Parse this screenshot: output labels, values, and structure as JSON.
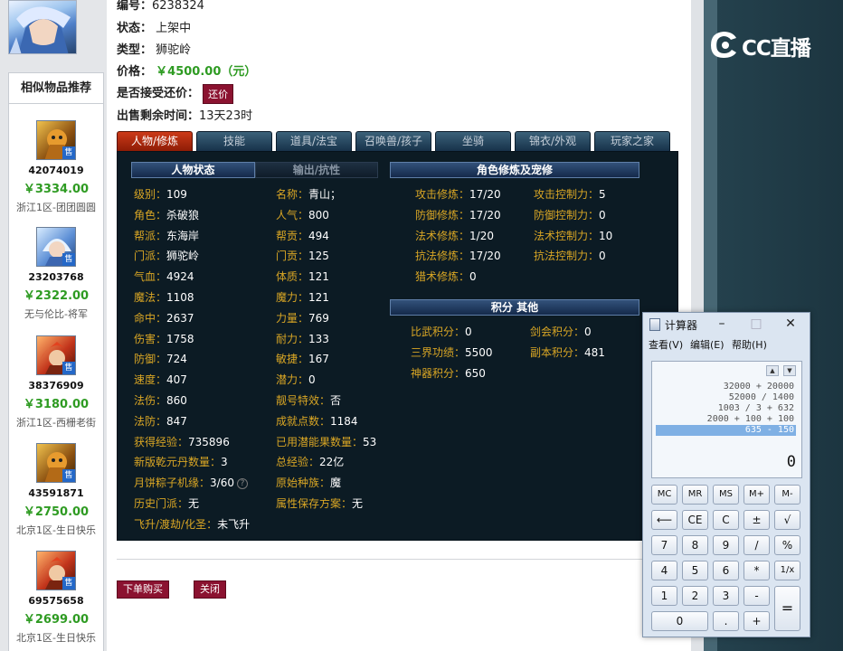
{
  "info": {
    "id_label": "编号：",
    "id_value": "6238324",
    "status_label": "状态：",
    "status_value": "上架中",
    "type_label": "类型：",
    "type_value": "狮驼岭",
    "price_label": "价格：",
    "price_value": "￥4500.00（元）",
    "bargain_label": "是否接受还价：",
    "bargain_button": "还价",
    "time_label": "出售剩余时间：",
    "time_value": "13天23时"
  },
  "sidebar": {
    "title": "相似物品推荐",
    "badge": "售",
    "items": [
      {
        "id": "42074019",
        "price": "￥3334.00",
        "server": "浙江1区-团团圆圆",
        "thumb": "gold-armor"
      },
      {
        "id": "23203768",
        "price": "￥2322.00",
        "server": "无与伦比-将军",
        "thumb": "blue-hair"
      },
      {
        "id": "38376909",
        "price": "￥3180.00",
        "server": "浙江1区-西栅老街",
        "thumb": "red-hair"
      },
      {
        "id": "43591871",
        "price": "￥2750.00",
        "server": "北京1区-生日快乐",
        "thumb": "gold-armor"
      },
      {
        "id": "69575658",
        "price": "￥2699.00",
        "server": "北京1区-生日快乐",
        "thumb": "red-hair"
      }
    ]
  },
  "tabs": [
    "人物/修炼",
    "技能",
    "道具/法宝",
    "召唤兽/孩子",
    "坐骑",
    "锦衣/外观",
    "玩家之家"
  ],
  "panel": {
    "left_header": "人物状态",
    "left_header_alt": "输出/抗性",
    "right_header1": "角色修炼及宠修",
    "right_header2": "积分 其他",
    "stats_col1": [
      {
        "k": "级别：",
        "v": "109"
      },
      {
        "k": "角色：",
        "v": "杀破狼"
      },
      {
        "k": "帮派：",
        "v": "东海岸"
      },
      {
        "k": "门派：",
        "v": "狮驼岭"
      },
      {
        "k": "气血：",
        "v": "4924"
      },
      {
        "k": "魔法：",
        "v": "1108"
      },
      {
        "k": "命中：",
        "v": "2637"
      },
      {
        "k": "伤害：",
        "v": "1758"
      },
      {
        "k": "防御：",
        "v": "724"
      },
      {
        "k": "速度：",
        "v": "407"
      },
      {
        "k": "法伤：",
        "v": "860"
      },
      {
        "k": "法防：",
        "v": "847"
      },
      {
        "k": "获得经验：",
        "v": "735896"
      },
      {
        "k": "新版乾元丹数量：",
        "v": "3"
      },
      {
        "k": "月饼粽子机缘：",
        "v": "3/60"
      },
      {
        "k": "历史门派：",
        "v": "无"
      },
      {
        "k": "飞升/渡劫/化圣：",
        "v": "未飞升"
      }
    ],
    "stats_col2": [
      {
        "k": "名称：",
        "v": "青山；"
      },
      {
        "k": "人气：",
        "v": "800"
      },
      {
        "k": "帮贡：",
        "v": "494"
      },
      {
        "k": "门贡：",
        "v": "125"
      },
      {
        "k": "体质：",
        "v": "121"
      },
      {
        "k": "魔力：",
        "v": "121"
      },
      {
        "k": "力量：",
        "v": "769"
      },
      {
        "k": "耐力：",
        "v": "133"
      },
      {
        "k": "敏捷：",
        "v": "167"
      },
      {
        "k": "潜力：",
        "v": "0"
      },
      {
        "k": "靓号特效：",
        "v": "否"
      },
      {
        "k": "成就点数：",
        "v": "1184"
      },
      {
        "k": "已用潜能果数量：",
        "v": "53"
      },
      {
        "k": "总经验：",
        "v": "22亿"
      },
      {
        "k": "原始种族：",
        "v": "魔"
      },
      {
        "k": "属性保存方案：",
        "v": "无"
      }
    ],
    "cultivation_a": [
      {
        "k": "攻击修炼：",
        "v": "17/20"
      },
      {
        "k": "防御修炼：",
        "v": "17/20"
      },
      {
        "k": "法术修炼：",
        "v": "1/20"
      },
      {
        "k": "抗法修炼：",
        "v": "17/20"
      },
      {
        "k": "猎术修炼：",
        "v": "0"
      }
    ],
    "cultivation_b": [
      {
        "k": "攻击控制力：",
        "v": "5"
      },
      {
        "k": "防御控制力：",
        "v": "0"
      },
      {
        "k": "法术控制力：",
        "v": "10"
      },
      {
        "k": "抗法控制力：",
        "v": "0"
      }
    ],
    "points_a": [
      {
        "k": "比武积分：",
        "v": "0"
      },
      {
        "k": "三界功绩：",
        "v": "5500"
      },
      {
        "k": "神器积分：",
        "v": "650"
      }
    ],
    "points_b": [
      {
        "k": "剑会积分：",
        "v": "0"
      },
      {
        "k": "副本积分：",
        "v": "481"
      }
    ]
  },
  "actions": {
    "order": "下单购买",
    "close": "关闭"
  },
  "logo": {
    "text": "CC直播"
  },
  "calculator": {
    "title": "计算器",
    "menu": [
      "查看(V)",
      "编辑(E)",
      "帮助(H)"
    ],
    "history": [
      "32000 + 20000",
      "52000 / 1400",
      "1003 / 3 + 632",
      "2000 + 100 + 100",
      "635 - 150"
    ],
    "display": "0",
    "buttons": [
      [
        "MC",
        "MR",
        "MS",
        "M+",
        "M-"
      ],
      [
        "⟵",
        "CE",
        "C",
        "±",
        "√"
      ],
      [
        "7",
        "8",
        "9",
        "/",
        "%"
      ],
      [
        "4",
        "5",
        "6",
        "*",
        "1/x"
      ],
      [
        "1",
        "2",
        "3",
        "-",
        "="
      ],
      [
        "0",
        ".",
        "+"
      ]
    ]
  }
}
